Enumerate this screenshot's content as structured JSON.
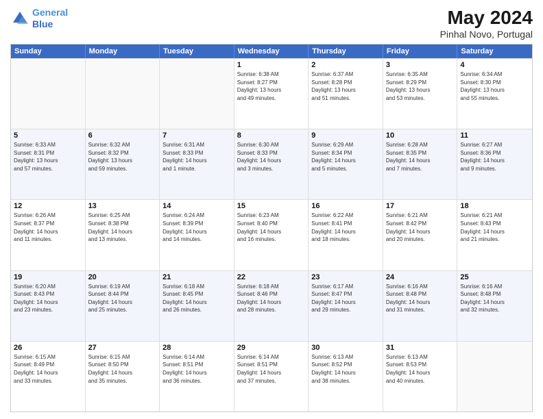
{
  "header": {
    "logo_line1": "General",
    "logo_line2": "Blue",
    "main_title": "May 2024",
    "subtitle": "Pinhal Novo, Portugal"
  },
  "calendar": {
    "days": [
      "Sunday",
      "Monday",
      "Tuesday",
      "Wednesday",
      "Thursday",
      "Friday",
      "Saturday"
    ],
    "weeks": [
      [
        {
          "num": "",
          "lines": []
        },
        {
          "num": "",
          "lines": []
        },
        {
          "num": "",
          "lines": []
        },
        {
          "num": "1",
          "lines": [
            "Sunrise: 6:38 AM",
            "Sunset: 8:27 PM",
            "Daylight: 13 hours",
            "and 49 minutes."
          ]
        },
        {
          "num": "2",
          "lines": [
            "Sunrise: 6:37 AM",
            "Sunset: 8:28 PM",
            "Daylight: 13 hours",
            "and 51 minutes."
          ]
        },
        {
          "num": "3",
          "lines": [
            "Sunrise: 6:35 AM",
            "Sunset: 8:29 PM",
            "Daylight: 13 hours",
            "and 53 minutes."
          ]
        },
        {
          "num": "4",
          "lines": [
            "Sunrise: 6:34 AM",
            "Sunset: 8:30 PM",
            "Daylight: 13 hours",
            "and 55 minutes."
          ]
        }
      ],
      [
        {
          "num": "5",
          "lines": [
            "Sunrise: 6:33 AM",
            "Sunset: 8:31 PM",
            "Daylight: 13 hours",
            "and 57 minutes."
          ]
        },
        {
          "num": "6",
          "lines": [
            "Sunrise: 6:32 AM",
            "Sunset: 8:32 PM",
            "Daylight: 13 hours",
            "and 59 minutes."
          ]
        },
        {
          "num": "7",
          "lines": [
            "Sunrise: 6:31 AM",
            "Sunset: 8:33 PM",
            "Daylight: 14 hours",
            "and 1 minute."
          ]
        },
        {
          "num": "8",
          "lines": [
            "Sunrise: 6:30 AM",
            "Sunset: 8:33 PM",
            "Daylight: 14 hours",
            "and 3 minutes."
          ]
        },
        {
          "num": "9",
          "lines": [
            "Sunrise: 6:29 AM",
            "Sunset: 8:34 PM",
            "Daylight: 14 hours",
            "and 5 minutes."
          ]
        },
        {
          "num": "10",
          "lines": [
            "Sunrise: 6:28 AM",
            "Sunset: 8:35 PM",
            "Daylight: 14 hours",
            "and 7 minutes."
          ]
        },
        {
          "num": "11",
          "lines": [
            "Sunrise: 6:27 AM",
            "Sunset: 8:36 PM",
            "Daylight: 14 hours",
            "and 9 minutes."
          ]
        }
      ],
      [
        {
          "num": "12",
          "lines": [
            "Sunrise: 6:26 AM",
            "Sunset: 8:37 PM",
            "Daylight: 14 hours",
            "and 11 minutes."
          ]
        },
        {
          "num": "13",
          "lines": [
            "Sunrise: 6:25 AM",
            "Sunset: 8:38 PM",
            "Daylight: 14 hours",
            "and 13 minutes."
          ]
        },
        {
          "num": "14",
          "lines": [
            "Sunrise: 6:24 AM",
            "Sunset: 8:39 PM",
            "Daylight: 14 hours",
            "and 14 minutes."
          ]
        },
        {
          "num": "15",
          "lines": [
            "Sunrise: 6:23 AM",
            "Sunset: 8:40 PM",
            "Daylight: 14 hours",
            "and 16 minutes."
          ]
        },
        {
          "num": "16",
          "lines": [
            "Sunrise: 6:22 AM",
            "Sunset: 8:41 PM",
            "Daylight: 14 hours",
            "and 18 minutes."
          ]
        },
        {
          "num": "17",
          "lines": [
            "Sunrise: 6:21 AM",
            "Sunset: 8:42 PM",
            "Daylight: 14 hours",
            "and 20 minutes."
          ]
        },
        {
          "num": "18",
          "lines": [
            "Sunrise: 6:21 AM",
            "Sunset: 8:43 PM",
            "Daylight: 14 hours",
            "and 21 minutes."
          ]
        }
      ],
      [
        {
          "num": "19",
          "lines": [
            "Sunrise: 6:20 AM",
            "Sunset: 8:43 PM",
            "Daylight: 14 hours",
            "and 23 minutes."
          ]
        },
        {
          "num": "20",
          "lines": [
            "Sunrise: 6:19 AM",
            "Sunset: 8:44 PM",
            "Daylight: 14 hours",
            "and 25 minutes."
          ]
        },
        {
          "num": "21",
          "lines": [
            "Sunrise: 6:18 AM",
            "Sunset: 8:45 PM",
            "Daylight: 14 hours",
            "and 26 minutes."
          ]
        },
        {
          "num": "22",
          "lines": [
            "Sunrise: 6:18 AM",
            "Sunset: 8:46 PM",
            "Daylight: 14 hours",
            "and 28 minutes."
          ]
        },
        {
          "num": "23",
          "lines": [
            "Sunrise: 6:17 AM",
            "Sunset: 8:47 PM",
            "Daylight: 14 hours",
            "and 29 minutes."
          ]
        },
        {
          "num": "24",
          "lines": [
            "Sunrise: 6:16 AM",
            "Sunset: 8:48 PM",
            "Daylight: 14 hours",
            "and 31 minutes."
          ]
        },
        {
          "num": "25",
          "lines": [
            "Sunrise: 6:16 AM",
            "Sunset: 8:48 PM",
            "Daylight: 14 hours",
            "and 32 minutes."
          ]
        }
      ],
      [
        {
          "num": "26",
          "lines": [
            "Sunrise: 6:15 AM",
            "Sunset: 8:49 PM",
            "Daylight: 14 hours",
            "and 33 minutes."
          ]
        },
        {
          "num": "27",
          "lines": [
            "Sunrise: 6:15 AM",
            "Sunset: 8:50 PM",
            "Daylight: 14 hours",
            "and 35 minutes."
          ]
        },
        {
          "num": "28",
          "lines": [
            "Sunrise: 6:14 AM",
            "Sunset: 8:51 PM",
            "Daylight: 14 hours",
            "and 36 minutes."
          ]
        },
        {
          "num": "29",
          "lines": [
            "Sunrise: 6:14 AM",
            "Sunset: 8:51 PM",
            "Daylight: 14 hours",
            "and 37 minutes."
          ]
        },
        {
          "num": "30",
          "lines": [
            "Sunrise: 6:13 AM",
            "Sunset: 8:52 PM",
            "Daylight: 14 hours",
            "and 38 minutes."
          ]
        },
        {
          "num": "31",
          "lines": [
            "Sunrise: 6:13 AM",
            "Sunset: 8:53 PM",
            "Daylight: 14 hours",
            "and 40 minutes."
          ]
        },
        {
          "num": "",
          "lines": []
        }
      ]
    ]
  }
}
